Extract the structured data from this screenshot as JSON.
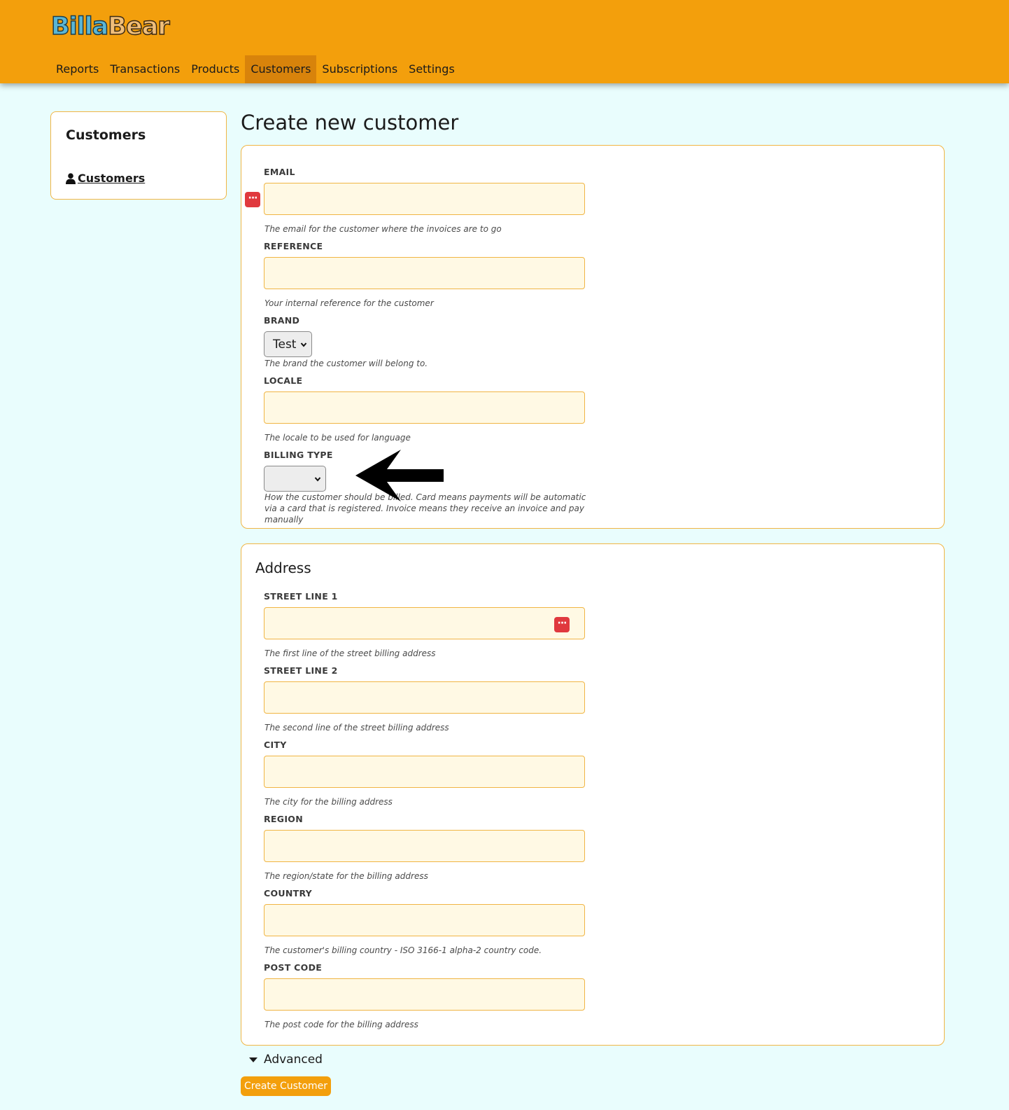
{
  "app": {
    "logo_part1": "Billa",
    "logo_part2": "Bear"
  },
  "nav": {
    "items": [
      "Reports",
      "Transactions",
      "Products",
      "Customers",
      "Subscriptions",
      "Settings"
    ],
    "active": "Customers"
  },
  "sidebar": {
    "title": "Customers",
    "link_label": "Customers"
  },
  "page": {
    "title": "Create new customer"
  },
  "general": {
    "email": {
      "label": "EMAIL",
      "value": "",
      "help": "The email for the customer where the invoices are to go"
    },
    "reference": {
      "label": "REFERENCE",
      "value": "",
      "help": "Your internal reference for the customer"
    },
    "brand": {
      "label": "BRAND",
      "selected": "Test",
      "help": "The brand the customer will belong to."
    },
    "locale": {
      "label": "LOCALE",
      "value": "",
      "help": "The locale to be used for language"
    },
    "billing_type": {
      "label": "BILLING TYPE",
      "selected": "",
      "help": "How the customer should be billed. Card means payments will be automatic via a card that is registered. Invoice means they receive an invoice and pay manually"
    }
  },
  "address": {
    "heading": "Address",
    "street1": {
      "label": "STREET LINE 1",
      "value": "",
      "help": "The first line of the street billing address"
    },
    "street2": {
      "label": "STREET LINE 2",
      "value": "",
      "help": "The second line of the street billing address"
    },
    "city": {
      "label": "CITY",
      "value": "",
      "help": "The city for the billing address"
    },
    "region": {
      "label": "REGION",
      "value": "",
      "help": "The region/state for the billing address"
    },
    "country": {
      "label": "COUNTRY",
      "value": "",
      "help": "The customer's billing country - ISO 3166-1 alpha-2 country code."
    },
    "postcode": {
      "label": "POST CODE",
      "value": "",
      "help": "The post code for the billing address"
    }
  },
  "advanced_label": "Advanced",
  "submit_label": "Create Customer",
  "icons": {
    "password_manager": "password-manager-icon",
    "arrow": "left-arrow-annotation-icon",
    "person": "person-icon",
    "chevron": "chevron-down-icon"
  },
  "colors": {
    "header": "#f39f0c",
    "active_nav": "#d8830b",
    "background": "#e9fdfd",
    "input_bg": "#fff9e4",
    "border": "#f0b544"
  }
}
